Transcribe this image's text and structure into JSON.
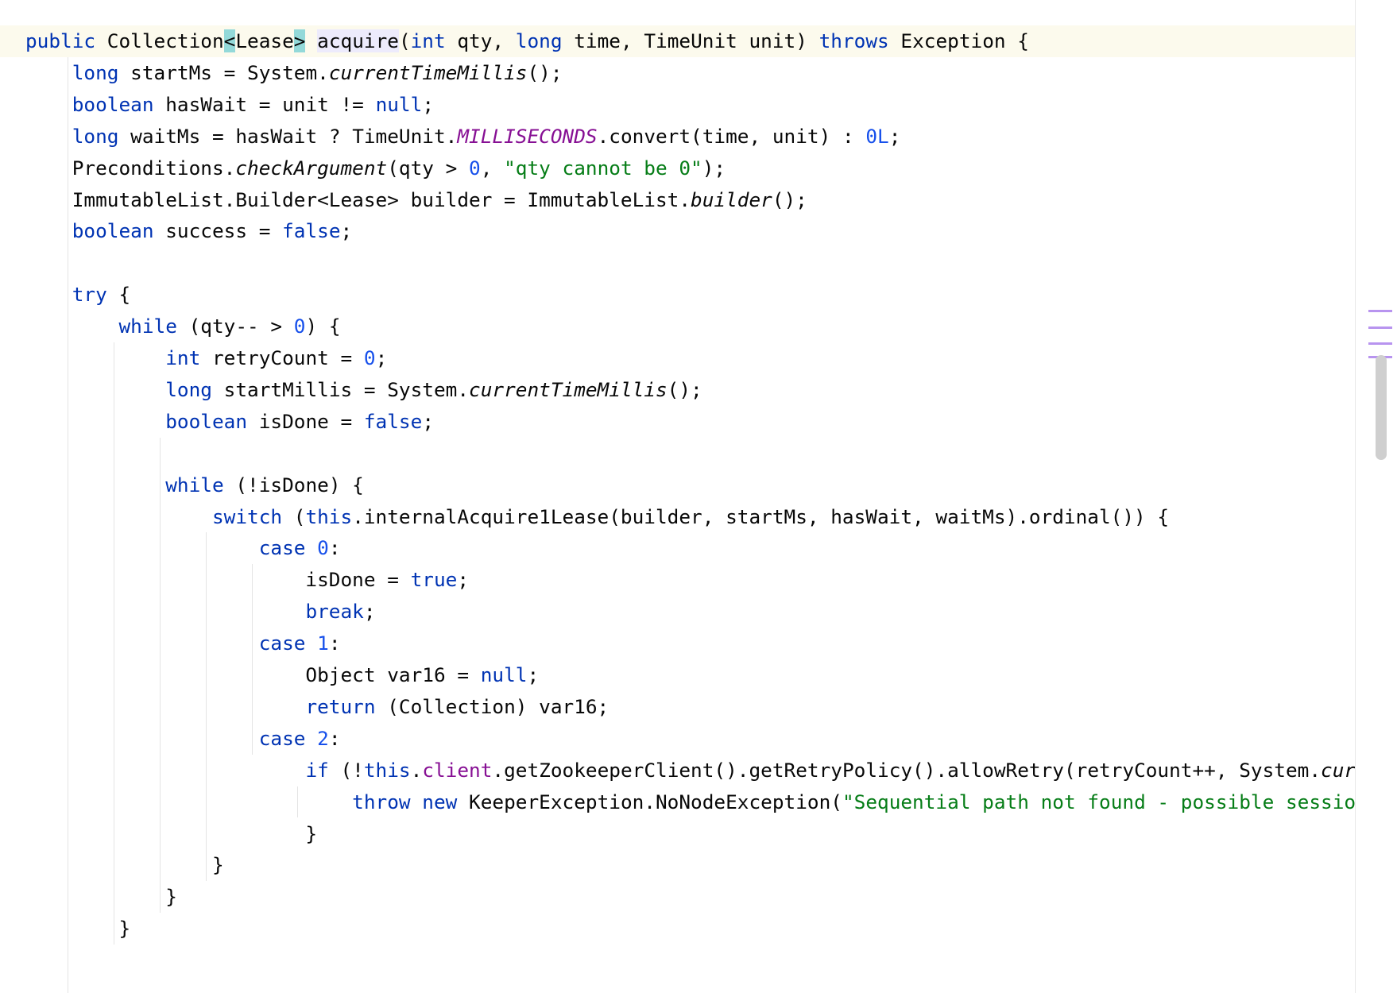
{
  "editor": {
    "language": "Java",
    "lines": [
      [
        [
          "kw",
          "public"
        ],
        [
          "plain",
          " Collection"
        ],
        [
          "hlb",
          "<"
        ],
        [
          "plain",
          "Lease"
        ],
        [
          "hlb",
          ">"
        ],
        [
          "plain",
          " "
        ],
        [
          "hli",
          "acquire"
        ],
        [
          "plain",
          "("
        ],
        [
          "kw",
          "int"
        ],
        [
          "plain",
          " qty, "
        ],
        [
          "kw",
          "long"
        ],
        [
          "plain",
          " time, TimeUnit unit) "
        ],
        [
          "kw",
          "throws"
        ],
        [
          "plain",
          " Exception {"
        ]
      ],
      [
        [
          "plain",
          "    "
        ],
        [
          "kw",
          "long"
        ],
        [
          "plain",
          " startMs = System."
        ],
        [
          "it",
          "currentTimeMillis"
        ],
        [
          "plain",
          "();"
        ]
      ],
      [
        [
          "plain",
          "    "
        ],
        [
          "kw",
          "boolean"
        ],
        [
          "plain",
          " hasWait = unit != "
        ],
        [
          "kw",
          "null"
        ],
        [
          "plain",
          ";"
        ]
      ],
      [
        [
          "plain",
          "    "
        ],
        [
          "kw",
          "long"
        ],
        [
          "plain",
          " waitMs = hasWait ? TimeUnit."
        ],
        [
          "st",
          "MILLISECONDS"
        ],
        [
          "plain",
          ".convert(time, unit) : "
        ],
        [
          "num",
          "0L"
        ],
        [
          "plain",
          ";"
        ]
      ],
      [
        [
          "plain",
          "    Preconditions."
        ],
        [
          "it",
          "checkArgument"
        ],
        [
          "plain",
          "(qty > "
        ],
        [
          "num",
          "0"
        ],
        [
          "plain",
          ", "
        ],
        [
          "str",
          "\"qty cannot be 0\""
        ],
        [
          "plain",
          ");"
        ]
      ],
      [
        [
          "plain",
          "    ImmutableList.Builder<Lease> builder = ImmutableList."
        ],
        [
          "it",
          "builder"
        ],
        [
          "plain",
          "();"
        ]
      ],
      [
        [
          "plain",
          "    "
        ],
        [
          "kw",
          "boolean"
        ],
        [
          "plain",
          " success = "
        ],
        [
          "kw",
          "false"
        ],
        [
          "plain",
          ";"
        ]
      ],
      [],
      [
        [
          "plain",
          "    "
        ],
        [
          "kw",
          "try"
        ],
        [
          "plain",
          " {"
        ]
      ],
      [
        [
          "plain",
          "        "
        ],
        [
          "kw",
          "while"
        ],
        [
          "plain",
          " (qty-- > "
        ],
        [
          "num",
          "0"
        ],
        [
          "plain",
          ") {"
        ]
      ],
      [
        [
          "plain",
          "            "
        ],
        [
          "kw",
          "int"
        ],
        [
          "plain",
          " retryCount = "
        ],
        [
          "num",
          "0"
        ],
        [
          "plain",
          ";"
        ]
      ],
      [
        [
          "plain",
          "            "
        ],
        [
          "kw",
          "long"
        ],
        [
          "plain",
          " startMillis = System."
        ],
        [
          "it",
          "currentTimeMillis"
        ],
        [
          "plain",
          "();"
        ]
      ],
      [
        [
          "plain",
          "            "
        ],
        [
          "kw",
          "boolean"
        ],
        [
          "plain",
          " isDone = "
        ],
        [
          "kw",
          "false"
        ],
        [
          "plain",
          ";"
        ]
      ],
      [],
      [
        [
          "plain",
          "            "
        ],
        [
          "kw",
          "while"
        ],
        [
          "plain",
          " (!isDone) {"
        ]
      ],
      [
        [
          "plain",
          "                "
        ],
        [
          "kw",
          "switch"
        ],
        [
          "plain",
          " ("
        ],
        [
          "kw",
          "this"
        ],
        [
          "plain",
          ".internalAcquire1Lease(builder, startMs, hasWait, waitMs).ordinal()) {"
        ]
      ],
      [
        [
          "plain",
          "                    "
        ],
        [
          "kw",
          "case"
        ],
        [
          "plain",
          " "
        ],
        [
          "num",
          "0"
        ],
        [
          "plain",
          ":"
        ]
      ],
      [
        [
          "plain",
          "                        isDone = "
        ],
        [
          "kw",
          "true"
        ],
        [
          "plain",
          ";"
        ]
      ],
      [
        [
          "plain",
          "                        "
        ],
        [
          "kw",
          "break"
        ],
        [
          "plain",
          ";"
        ]
      ],
      [
        [
          "plain",
          "                    "
        ],
        [
          "kw",
          "case"
        ],
        [
          "plain",
          " "
        ],
        [
          "num",
          "1"
        ],
        [
          "plain",
          ":"
        ]
      ],
      [
        [
          "plain",
          "                        Object var16 = "
        ],
        [
          "kw",
          "null"
        ],
        [
          "plain",
          ";"
        ]
      ],
      [
        [
          "plain",
          "                        "
        ],
        [
          "kw",
          "return"
        ],
        [
          "plain",
          " (Collection) var16;"
        ]
      ],
      [
        [
          "plain",
          "                    "
        ],
        [
          "kw",
          "case"
        ],
        [
          "plain",
          " "
        ],
        [
          "num",
          "2"
        ],
        [
          "plain",
          ":"
        ]
      ],
      [
        [
          "plain",
          "                        "
        ],
        [
          "kw",
          "if"
        ],
        [
          "plain",
          " (!"
        ],
        [
          "kw",
          "this"
        ],
        [
          "plain",
          "."
        ],
        [
          "fld",
          "client"
        ],
        [
          "plain",
          ".getZookeeperClient().getRetryPolicy().allowRetry(retryCount++, System."
        ],
        [
          "it",
          "currentTi"
        ]
      ],
      [
        [
          "plain",
          "                            "
        ],
        [
          "kw",
          "throw"
        ],
        [
          "plain",
          " "
        ],
        [
          "kw",
          "new"
        ],
        [
          "plain",
          " KeeperException.NoNodeException("
        ],
        [
          "str",
          "\"Sequential path not found - possible session loss"
        ]
      ],
      [
        [
          "plain",
          "                        }"
        ]
      ],
      [
        [
          "plain",
          "                }"
        ]
      ],
      [
        [
          "plain",
          "            }"
        ]
      ],
      [
        [
          "plain",
          "        }"
        ]
      ],
      [],
      [
        [
          "plain",
          "                  ."
        ]
      ]
    ]
  }
}
